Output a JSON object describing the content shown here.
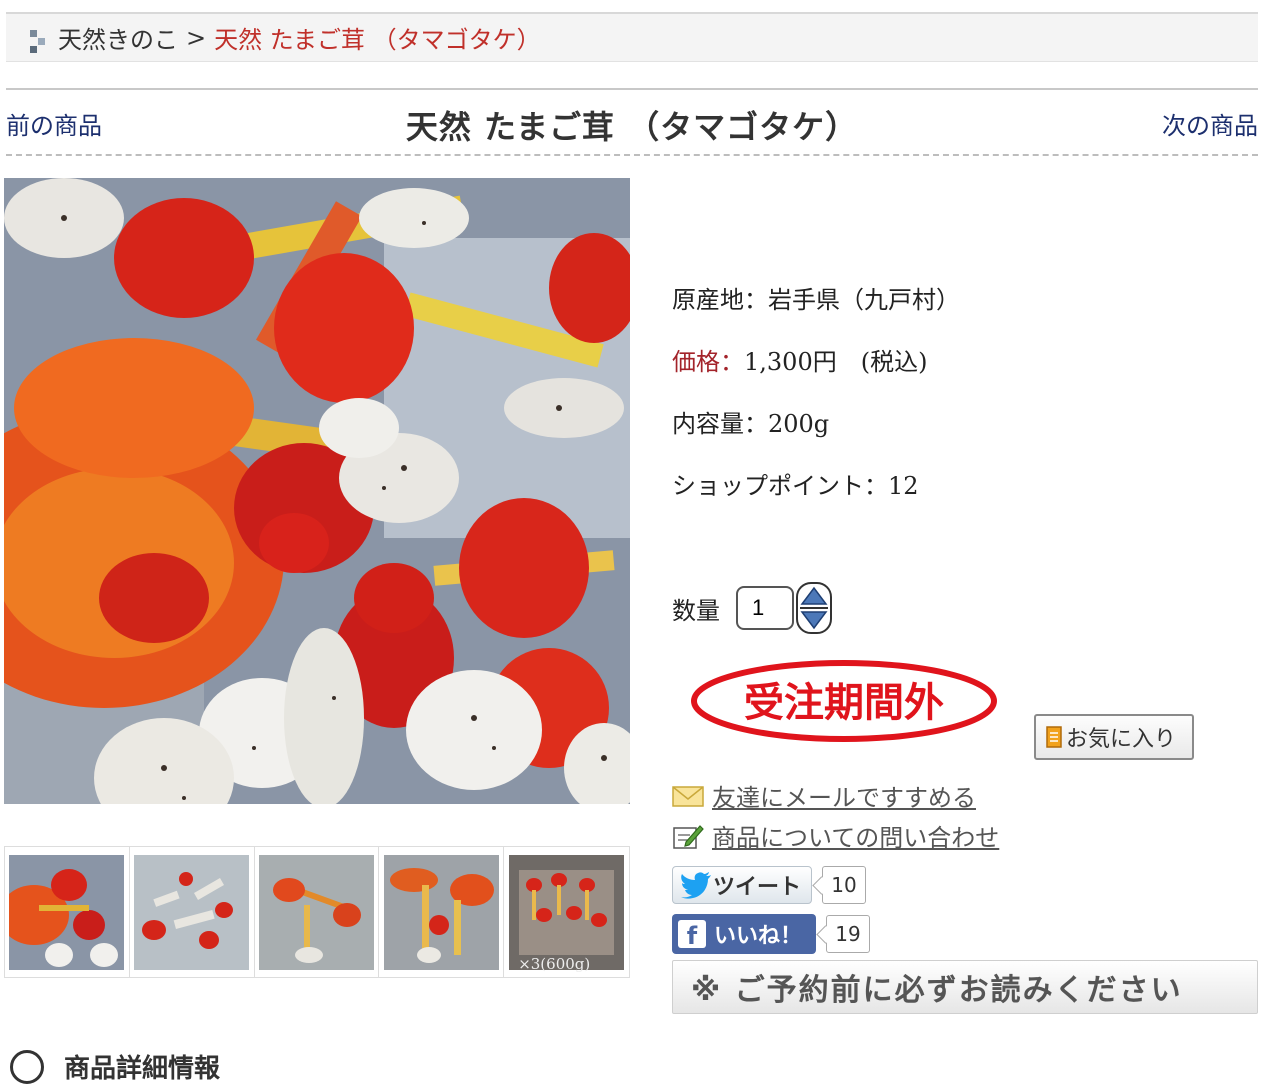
{
  "breadcrumb": {
    "home": "天然きのこ",
    "separator": ">",
    "current": "天然 たまご茸 （タマゴタケ）"
  },
  "nav": {
    "prev": "前の商品",
    "next": "次の商品",
    "title": "天然 たまご茸 （タマゴタケ）"
  },
  "gallery": {
    "thumbnails": [
      {
        "caption": ""
      },
      {
        "caption": ""
      },
      {
        "caption": ""
      },
      {
        "caption": ""
      },
      {
        "caption": "×3(600g)"
      }
    ]
  },
  "info": {
    "origin": "原産地：岩手県（九戸村）",
    "price_label": "価格：",
    "price_value": "1,300円　(税込)",
    "content": "内容量：200g",
    "points": "ショップポイント：12"
  },
  "quantity": {
    "label": "数量",
    "value": "1"
  },
  "stamp": {
    "text": "受注期間外",
    "color": "#e0141c"
  },
  "favorite": {
    "label": "お気に入り"
  },
  "links": {
    "mail": "友達にメールですすめる",
    "inquiry": "商品についての問い合わせ"
  },
  "social": {
    "tweet_label": "ツイート",
    "tweet_count": "10",
    "like_label": "いいね！",
    "like_count": "19",
    "brand_twitter": "#1da1f2",
    "brand_facebook": "#4a66a4"
  },
  "notice": {
    "label": "※ ご予約前に必ずお読みください"
  },
  "details": {
    "heading": "商品詳細情報"
  }
}
